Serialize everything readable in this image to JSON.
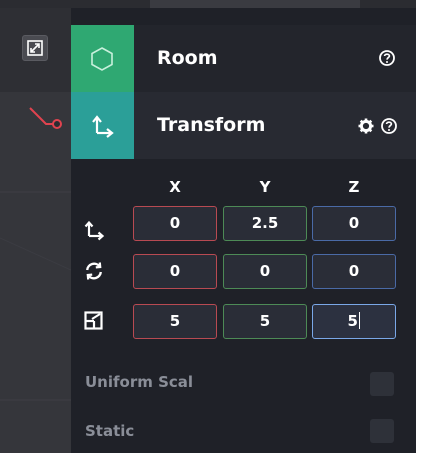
{
  "inspector": {
    "components": [
      {
        "name": "Room",
        "icon": "hexagon-icon",
        "actions": [
          "help-icon"
        ]
      },
      {
        "name": "Transform",
        "icon": "transform-axes-icon",
        "actions": [
          "gear-icon",
          "help-icon"
        ]
      }
    ],
    "transform": {
      "axis_headers": [
        "X",
        "Y",
        "Z"
      ],
      "rows": [
        {
          "icon": "position-icon",
          "x": "0",
          "y": "2.5",
          "z": "0"
        },
        {
          "icon": "rotation-icon",
          "x": "0",
          "y": "0",
          "z": "0"
        },
        {
          "icon": "scale-icon",
          "x": "5",
          "y": "5",
          "z": "5"
        }
      ],
      "focused_field": "scale.z"
    },
    "properties": [
      {
        "label": "Uniform Scal",
        "checked": false
      },
      {
        "label": "Static",
        "checked": false
      }
    ]
  },
  "colors": {
    "room_tile": "#2fa872",
    "transform_tile": "#2b9f98",
    "x_border": "#b84a52",
    "y_border": "#4d8a56",
    "z_border": "#4a6aa6",
    "focus_border": "#7aa8e8",
    "link_line": "#e0434f"
  }
}
